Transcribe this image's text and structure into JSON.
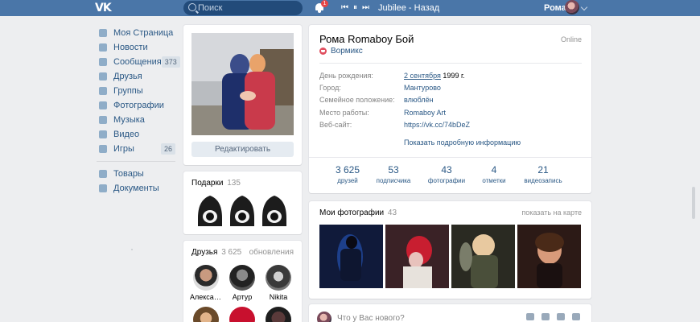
{
  "header": {
    "search_placeholder": "Поиск",
    "notifications_count": "1",
    "player": {
      "track": "Jubilee - Назад"
    },
    "user_name": "Рома"
  },
  "menu": {
    "items": [
      {
        "label": "Моя Страница",
        "count": ""
      },
      {
        "label": "Новости",
        "count": ""
      },
      {
        "label": "Сообщения",
        "count": "373"
      },
      {
        "label": "Друзья",
        "count": ""
      },
      {
        "label": "Группы",
        "count": ""
      },
      {
        "label": "Фотографии",
        "count": ""
      },
      {
        "label": "Музыка",
        "count": ""
      },
      {
        "label": "Видео",
        "count": ""
      },
      {
        "label": "Игры",
        "count": "26"
      }
    ],
    "extra": [
      {
        "label": "Товары"
      },
      {
        "label": "Документы"
      }
    ]
  },
  "avatar": {
    "edit_label": "Редактировать"
  },
  "gifts": {
    "title": "Подарки",
    "count": "135"
  },
  "friends": {
    "title": "Друзья",
    "count": "3 625",
    "updates": "обновления",
    "list": [
      {
        "name": "Александ…"
      },
      {
        "name": "Артур"
      },
      {
        "name": "Nikita"
      }
    ]
  },
  "profile": {
    "name": "Рома Romaboy Бой",
    "status": "Вормикс",
    "online": "Online",
    "info": [
      {
        "label": "День рождения:",
        "value_link": "2 сентября",
        "value_tail": " 1999 г."
      },
      {
        "label": "Город:",
        "value_link": "Мантурово",
        "value_tail": ""
      },
      {
        "label": "Семейное положение:",
        "value_link": "влюблён",
        "value_tail": ""
      },
      {
        "label": "Место работы:",
        "value_link": "Romaboy Art",
        "value_tail": ""
      },
      {
        "label": "Веб-сайт:",
        "value_link": "https://vk.cc/74bDeZ",
        "value_tail": ""
      }
    ],
    "show_more": "Показать подробную информацию",
    "stats": [
      {
        "num": "3 625",
        "label": "друзей"
      },
      {
        "num": "53",
        "label": "подписчика"
      },
      {
        "num": "43",
        "label": "фотографии"
      },
      {
        "num": "4",
        "label": "отметки"
      },
      {
        "num": "21",
        "label": "видеозапись"
      }
    ]
  },
  "photos": {
    "title": "Мои фотографии",
    "count": "43",
    "map_link": "показать на карте"
  },
  "post": {
    "placeholder": "Что у Вас нового?"
  },
  "colors": {
    "header": "#4a76a8",
    "link": "#2a5885",
    "background": "#edeef0"
  },
  "icons": [
    "vk-logo-icon",
    "search-icon",
    "bell-icon",
    "prev-icon",
    "pause-icon",
    "next-icon",
    "chevron-down-icon",
    "camera-icon",
    "video-icon",
    "music-icon",
    "menu-icon"
  ]
}
